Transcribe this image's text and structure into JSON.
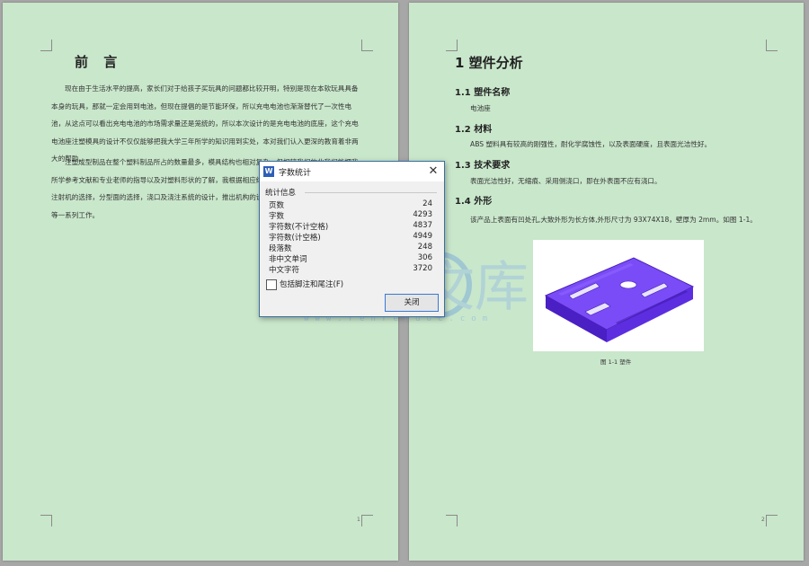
{
  "page1": {
    "title": "前 言",
    "paragraph1": "现在由于生活水平的提高，家长们对于给孩子买玩具的问题都比较开明，特别是现在本软玩具具备本身的玩具，那就一定会用到电池，但现在提倡的是节能环保，所以充电电池也渐渐替代了一次性电池，从这点可以看出充电电池的市场需求量还是笼统的，所以本次设计的是充电电池的底座，这个充电电池座注塑模具的设计不仅仅能够把我大学三年所学的知识用到实处，本对我们认入更深的教育着非两大的帮助。",
    "paragraph2": "注塑成型制品在整个塑料制品所占的数量最多，模具结构也相对复杂，但相较我们的此我们能把我所学参考文献和专业老师的指导以及对塑料形状的了解，我根据相应结构，使我很顺利的进入了元成了注射机的选择，分型面的选择，浇口及浇注系统的设计，推出机构的设计，模架的选择，冷却系统设计等一系列工作。",
    "page_number": "1"
  },
  "page2": {
    "chapter_title": "1 塑件分析",
    "s1_heading": "1.1 塑件名称",
    "s1_text": "电池座",
    "s2_heading": "1.2 材料",
    "s2_text": "ABS 塑料具有较高的刚强性，耐化学腐蚀性，以及表面硬度，且表面光洁性好。",
    "s3_heading": "1.3 技术要求",
    "s3_text": "表面光洁性好，无缩痕、采用侧浇口，即在外表面不应有浇口。",
    "s4_heading": "1.4 外形",
    "s4_text": "该产品上表面有凹处孔,大致外形为长方体,外形尺寸为 93X74X18，壁厚为 2mm。如图 1-1。",
    "figure_caption": "图 1-1 塑件",
    "page_number": "2"
  },
  "watermark": {
    "glyphs": "人人文库",
    "url": "www.renrendoc.com"
  },
  "dialog": {
    "title": "字数统计",
    "app_icon_glyph": "W",
    "close_glyph": "✕",
    "group_label": "统计信息",
    "stats": [
      {
        "label": "页数",
        "value": "24"
      },
      {
        "label": "字数",
        "value": "4293"
      },
      {
        "label": "字符数(不计空格)",
        "value": "4837"
      },
      {
        "label": "字符数(计空格)",
        "value": "4949"
      },
      {
        "label": "段落数",
        "value": "248"
      },
      {
        "label": "非中文单词",
        "value": "306"
      },
      {
        "label": "中文字符",
        "value": "3720"
      }
    ],
    "checkbox_label": "包括脚注和尾注(F)",
    "checkbox_checked": false,
    "close_button_label": "关闭"
  },
  "colors": {
    "page_background": "#c9e7cb",
    "workspace_background": "#a7a7a7",
    "part_purple": "#6a3df0",
    "dialog_accent": "#3a6ea5"
  }
}
